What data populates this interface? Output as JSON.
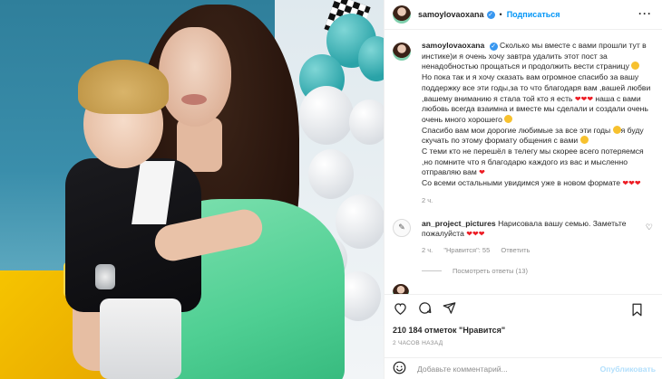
{
  "post": {
    "username": "samoylovaoxana",
    "follow_label": "Подписаться",
    "separator": "•",
    "caption_parts": [
      "Сколько мы вместе с вами прошли тут в инстике)и я очень хочу завтра удалить этот пост за ненадобностью прощаться и продолжить вести страницу ",
      "Но пока так и я хочу сказать вам огромное спасибо за вашу поддержку все эти годы,за то что благодаря вам ,вашей любви ,вашему вниманию я стала той кто я есть ",
      " наша с вами любовь всегда взаимна и вместе мы сделали и создали очень очень много хорошего ",
      "Спасибо вам мои дорогие любимые за все эти годы ",
      "я буду скучать по этому формату общения с вами ",
      "С теми кто не перешёл в телегу мы скорее всего потеряемся ,но помните что я благодарю каждого из вас и мысленно отправляю вам ",
      "Со всеми остальными увидимся уже в новом формате "
    ],
    "caption_time": "2 ч."
  },
  "comment": {
    "username": "an_project_pictures",
    "text": "Нарисовала вашу семью. Заметьте пожалуйста",
    "time": "2 ч.",
    "likes": "\"Нравится\": 55",
    "reply_label": "Ответить",
    "view_replies": "Посмотреть ответы (13)"
  },
  "footer": {
    "likes_count": "210 184 отметок \"Нравится\"",
    "posted_ago": "2 ЧАСОВ НАЗАД",
    "comment_placeholder": "Добавьте комментарий...",
    "publish_label": "Опубликовать"
  },
  "colors": {
    "accent": "#0095f6",
    "heart": "#ed1c24",
    "verified": "#3897f0"
  },
  "icons": [
    "more-icon",
    "heart-icon",
    "comment-icon",
    "share-icon",
    "bookmark-icon",
    "smile-icon",
    "verified-icon"
  ]
}
